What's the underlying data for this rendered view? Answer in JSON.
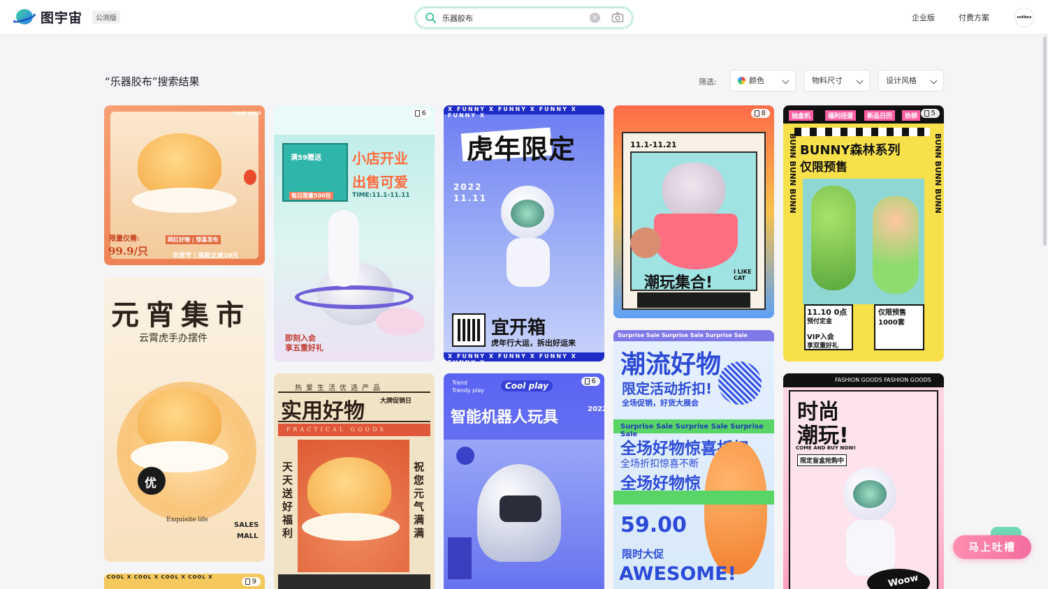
{
  "header": {
    "brand": "图宇宙",
    "beta_badge": "公测版",
    "search_value": "乐器胶布",
    "clear_glyph": "×",
    "nav": [
      "企业版",
      "付费方案"
    ],
    "avatar_text": "nolibox"
  },
  "results": {
    "title": "“乐器胶布”搜索结果",
    "filter_label": "筛选:",
    "filters": [
      "颜色",
      "物料尺寸",
      "设计风格"
    ]
  },
  "cards": {
    "c1": {
      "l1": "限量仅需:",
      "l2": "99.9/只",
      "l3": "网红好物 | 惊喜发布",
      "l4": "年货节 | 尾款立减10元",
      "logo": "YOUR LOGO"
    },
    "c2": {
      "badge": "6",
      "b1": "满59赠送",
      "b2": "小店开业",
      "b3": "出售可爱",
      "b4": "每日限量500份",
      "b5": "TIME:11.1-11.11",
      "b6": "即刻入会",
      "b7": "享五重好礼"
    },
    "c3": {
      "band": "X FUNNY X FUNNY X FUNNY X FUNNY X",
      "t1": "虎年限定",
      "t2": "2022",
      "t3": "11.11",
      "t4": "宜开箱",
      "t5": "虎年行大运，拆出好运来"
    },
    "c4": {
      "badge": "8",
      "date": "11.1-11.21",
      "t1": "潮玩集合!",
      "t2": "I LIKE CAT"
    },
    "c5": {
      "badge": "5",
      "tabs": [
        "抽盒机",
        "福利扭蛋",
        "新品日历",
        "热销"
      ],
      "t1": "BUNNY森林系列",
      "t2": "仅限预售",
      "side": "BUNN BUNN BUNN",
      "t3": "11.10 0点",
      "t4": "预付定金",
      "t5": "仅限预售",
      "t6": "1000套",
      "t7": "VIP入会",
      "t8": "享双重好礼"
    },
    "c6": {
      "t1": "元宵集市",
      "t2": "云霄虎手办摆件",
      "t3": "优",
      "t4": "Exquisite life",
      "t5": "SALES",
      "t6": "MALL"
    },
    "c7": {
      "t1": "热爱生活优选产品",
      "t2": "实用好物",
      "t3": "大牌促销日",
      "t4": "PRACTICAL GOODS",
      "t5": "天天送好福利",
      "t6": "祝您元气满满"
    },
    "c8": {
      "badge": "6",
      "t1": "Trend",
      "t2": "Trendy play",
      "t3": "Cool play",
      "t4": "智能机器人玩具",
      "t5": "2022"
    },
    "c9": {
      "band": "Surprise Sale Surprise Sale Surprise Sale",
      "t1": "潮流好物",
      "t2": "限定活动折扣!",
      "t3": "全场促销，好货大展会",
      "t4": "Surprise Sale Surprise Sale Surprise Sale",
      "t5": "全场好物惊喜折扣",
      "t6": "全场折扣惊喜不断",
      "t7": "全场好物惊",
      "t8": "59.00",
      "t9": "限时大促",
      "t10": "AWESOME!"
    },
    "c10": {
      "band": "FASHION GOODS FASHION GOODS",
      "t1": "时尚",
      "t2": "潮玩!",
      "t3": "COME AND BUY NOW!",
      "t4": "限定盲盒抢购中",
      "t5": "Woow"
    },
    "c11": {
      "badge": "9",
      "band": "COOL X COOL X COOL X COOL X"
    }
  },
  "feedback": {
    "label": "马上吐槽"
  },
  "colors": {
    "accent": "#3fcf9a",
    "feedback": "#f46c9e"
  }
}
